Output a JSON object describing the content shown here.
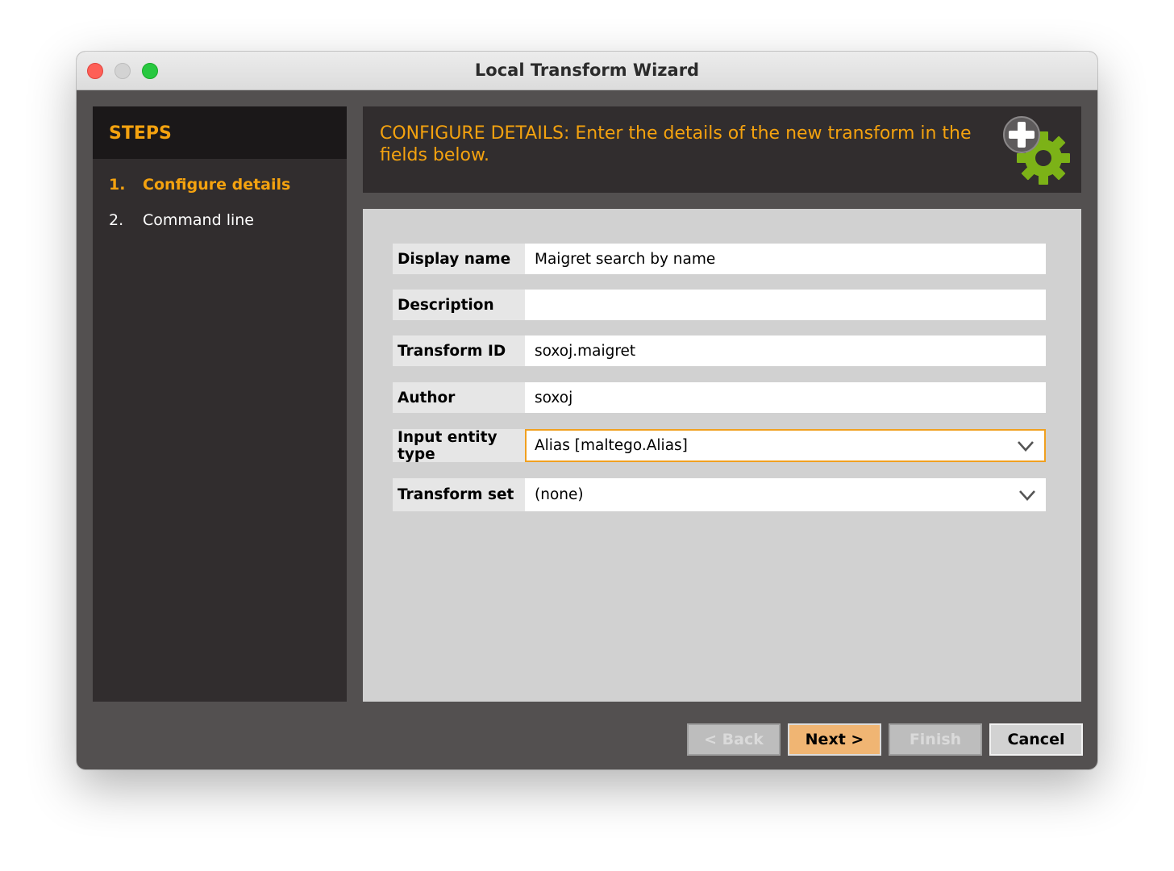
{
  "window": {
    "title": "Local Transform Wizard"
  },
  "steps": {
    "header": "STEPS",
    "items": [
      {
        "num": "1.",
        "label": "Configure details",
        "active": true
      },
      {
        "num": "2.",
        "label": "Command line",
        "active": false
      }
    ]
  },
  "banner": {
    "text": "CONFIGURE DETAILS: Enter the details of the new transform in the fields below.",
    "icon": "gear-plus-icon"
  },
  "form": {
    "display_name": {
      "label": "Display name",
      "value": "Maigret search by name"
    },
    "description": {
      "label": "Description",
      "value": ""
    },
    "transform_id": {
      "label": "Transform ID",
      "value": "soxoj.maigret"
    },
    "author": {
      "label": "Author",
      "value": "soxoj"
    },
    "input_entity_type": {
      "label": "Input entity type",
      "value": "Alias [maltego.Alias]"
    },
    "transform_set": {
      "label": "Transform set",
      "value": "(none)"
    }
  },
  "buttons": {
    "back": "< Back",
    "next": "Next >",
    "finish": "Finish",
    "cancel": "Cancel"
  },
  "colors": {
    "accent": "#f4a20f",
    "focus_border": "#f0a020",
    "gear_green": "#7cb217",
    "primary_button": "#f0b573"
  }
}
